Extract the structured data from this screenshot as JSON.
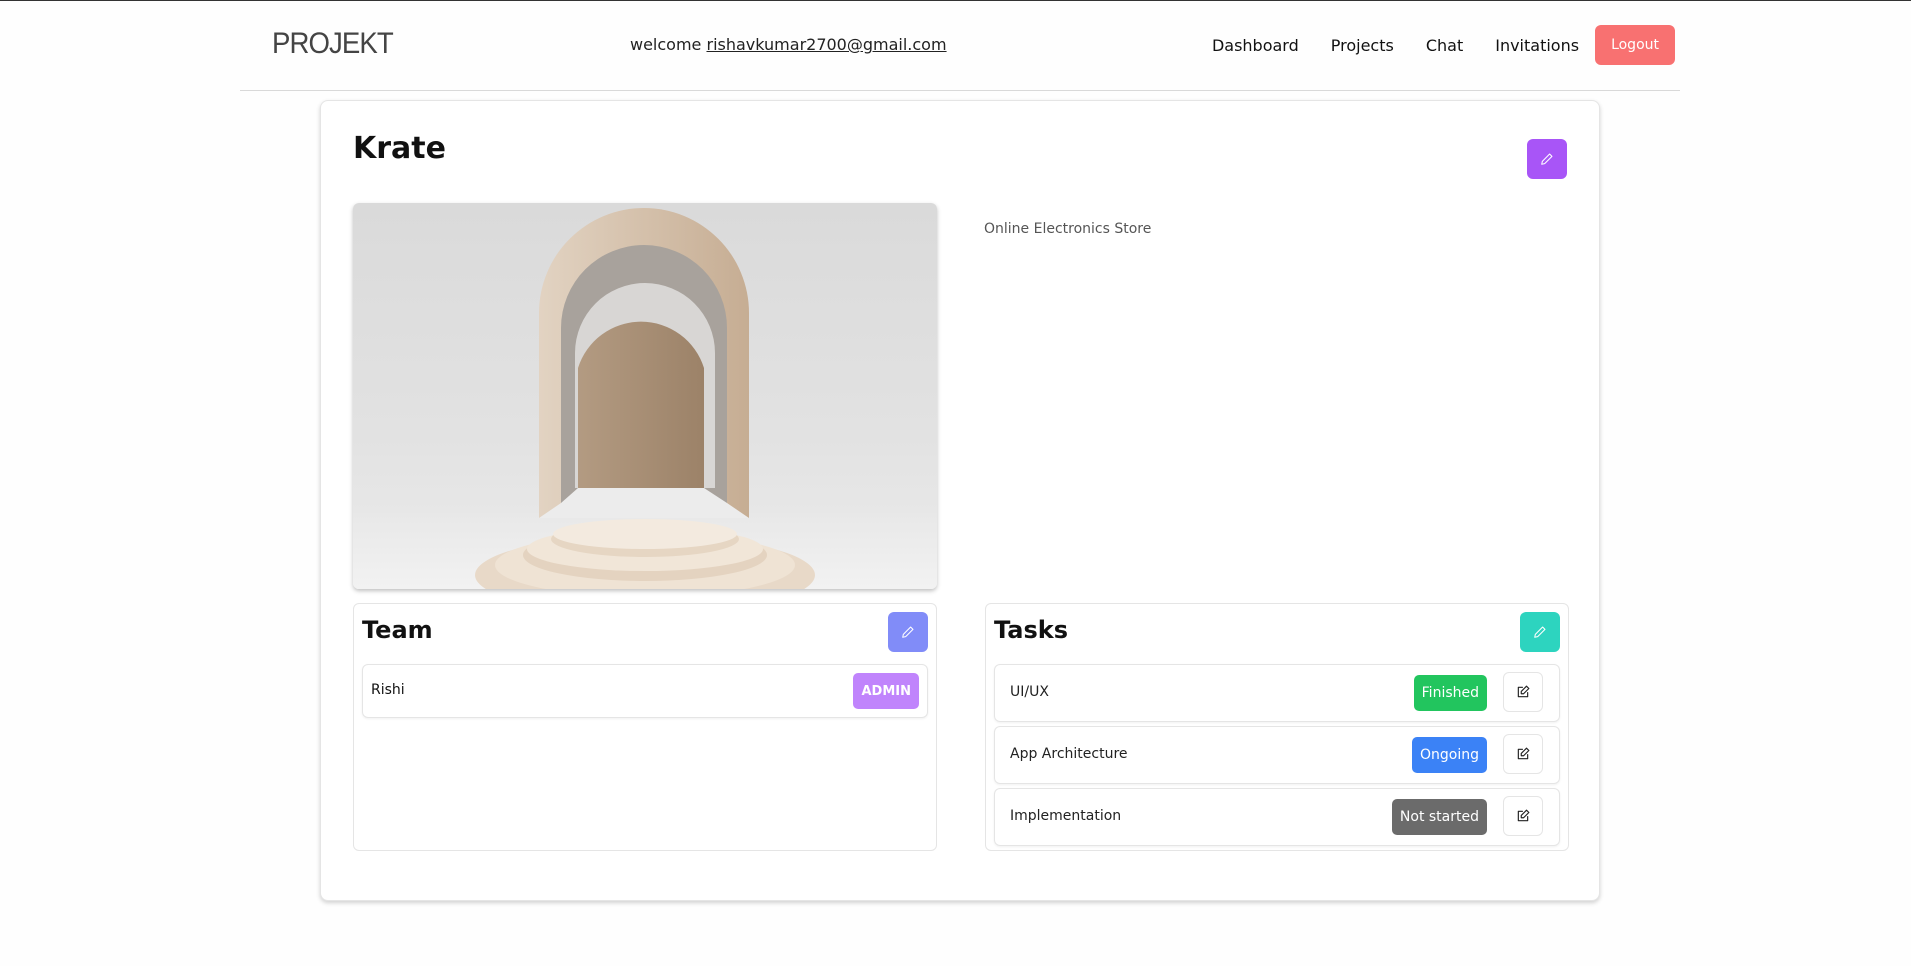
{
  "navbar": {
    "brand": "PROJEKT",
    "welcome_prefix": "welcome",
    "user_email": "rishavkumar2700@gmail.com",
    "links": [
      "Dashboard",
      "Projects",
      "Chat",
      "Invitations"
    ],
    "logout_label": "Logout"
  },
  "project": {
    "title": "Krate",
    "description": "Online Electronics Store",
    "image_alt": "arch-podium-image",
    "edit_icon": "pencil-icon"
  },
  "team": {
    "title": "Team",
    "edit_icon": "pencil-icon",
    "members": [
      {
        "name": "Rishi",
        "role": "ADMIN"
      }
    ]
  },
  "tasks": {
    "title": "Tasks",
    "edit_icon": "pencil-icon",
    "items": [
      {
        "name": "UI/UX",
        "status": "Finished",
        "status_color": "#22c55e"
      },
      {
        "name": "App Architecture",
        "status": "Ongoing",
        "status_color": "#3b82f6"
      },
      {
        "name": "Implementation",
        "status": "Not started",
        "status_color": "#6b6b6b"
      }
    ],
    "item_edit_icon": "edit-square-icon"
  },
  "colors": {
    "logout": "#f87171",
    "project_edit": "#a855f7",
    "team_edit": "#818cf8",
    "tasks_edit": "#2dd4bf",
    "admin_badge": "#c084fc"
  }
}
